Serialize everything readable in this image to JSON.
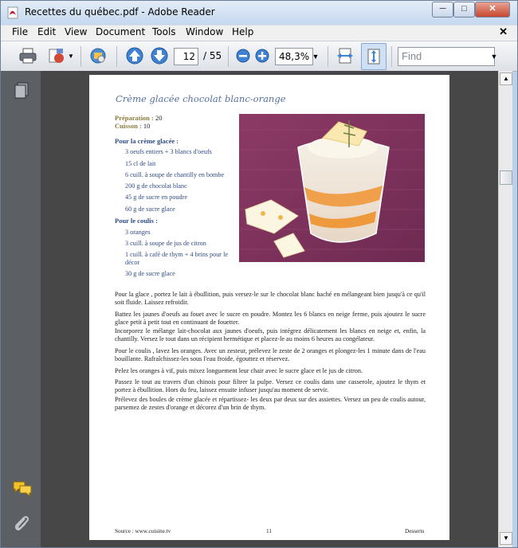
{
  "window": {
    "title": "Recettes du québec.pdf - Adobe Reader",
    "minimize": "─",
    "maximize": "□",
    "close": "✕"
  },
  "menu": {
    "items": [
      "File",
      "Edit",
      "View",
      "Document",
      "Tools",
      "Window",
      "Help"
    ],
    "close": "✕"
  },
  "toolbar": {
    "icons": [
      "print-icon",
      "create-pdf-icon",
      "collaborate-icon",
      "page-up-icon",
      "page-down-icon",
      "zoom-out-icon",
      "zoom-in-icon",
      "fit-width-icon",
      "fit-page-icon"
    ],
    "page_current": "12",
    "page_total": "/ 55",
    "zoom": "48,3%",
    "find_placeholder": "Find"
  },
  "navpane": {
    "icons": [
      "pages-icon",
      "comments-icon",
      "attachments-icon"
    ]
  },
  "document": {
    "title": "Crème glacée chocolat blanc-orange",
    "prep_label": "Préparation :",
    "prep_value": "20",
    "cook_label": "Cuisson :",
    "cook_value": "10",
    "ice_cream_heading": "Pour la crème glacée :",
    "ice_cream_items": [
      "3 oeufs entiers + 3 blancs d'oeufs",
      "15 cl de lait",
      "6 cuill. à soupe de chantilly en bombe",
      "200 g de chocolat blanc",
      "45 g de sucre en poudre",
      "60 g de sucre glace"
    ],
    "coulis_heading": "Pour le coulis :",
    "coulis_items": [
      "3 oranges",
      "3 cuill. à soupe de jus de citron",
      "1 cuill. à café de thym + 4 brins pour le décor",
      "30 g de sucre glace"
    ],
    "paragraphs": [
      "Pour la glace , portez le lait à ébullition, puis versez-le sur le chocolat blanc haché en mélangeant bien jusqu'à ce qu'il soit fluide. Laissez refroidir.",
      "Battez les jaunes d'oeufs au fouet avec le sucre en poudre. Montez les 6 blancs en neige ferme, puis ajoutez le sucre glace petit à petit tout en continuant de fouetter.",
      "Incorporez le mélange lait-chocolat aux jaunes d'oeufs, puis intégrez délicatement les blancs en neige et, enfin, la chantilly. Versez le tout dans un récipient hermétique et placez-le au moins 6 heures au congélateur.",
      "Pour le coulis , lavez les oranges. Avec un zesteur, prélevez le zeste de 2 oranges et plongez-les 1 minute dans de l'eau bouillante. Rafraîchissez-les sous l'eau froide, égouttez et réservez.",
      "Pelez les oranges à vif, puis mixez longuement leur chair avec le sucre glace et le jus de citron.",
      "Passez le tout au travers d'un chinois pour filtrer la pulpe. Versez ce coulis dans une casserole, ajoutez le thym et portez à ébullition. Hors du feu, laissez ensuite infuser jusqu'au moment de servir.",
      "Prélevez des boules de crème glacée et répartissez- les deux par deux sur des assiettes. Versez un peu de coulis autour, parsemez de zestes d'orange et décorez d'un brin de thym."
    ],
    "footer_source": "Source : www.cuisine.tv",
    "footer_page": "11",
    "footer_section": "Desserts"
  },
  "colors": {
    "accent": "#2f4b85",
    "title_blue": "#5570a0",
    "meta_olive": "#8a7c3a",
    "doc_bg": "#474747",
    "nav_bg": "#5c5f63"
  }
}
